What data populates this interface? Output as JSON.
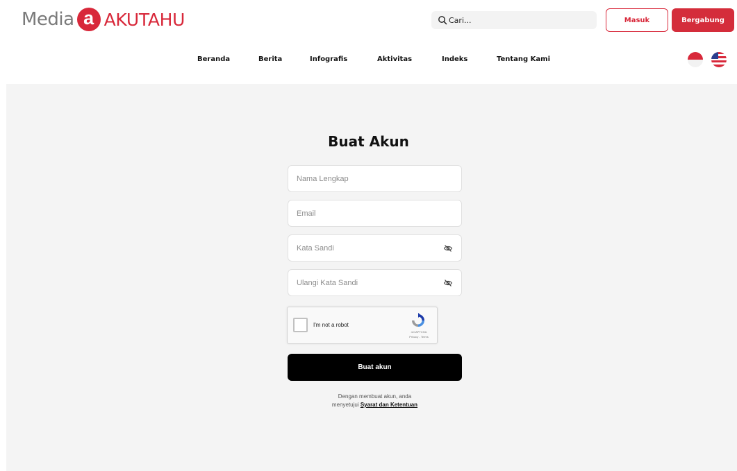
{
  "header": {
    "logo_text": "Media",
    "logo_badge": "a",
    "logo_brand": "AKUTAHU",
    "search_placeholder": "Cari...",
    "login_label": "Masuk",
    "register_label": "Bergabung"
  },
  "nav": {
    "items": [
      {
        "label": "Beranda"
      },
      {
        "label": "Berita"
      },
      {
        "label": "Infografis"
      },
      {
        "label": "Aktivitas"
      },
      {
        "label": "Indeks"
      },
      {
        "label": "Tentang Kami"
      }
    ],
    "languages": [
      "indonesia-flag-icon",
      "us-flag-icon"
    ]
  },
  "form": {
    "title": "Buat Akun",
    "full_name_placeholder": "Nama Lengkap",
    "email_placeholder": "Email",
    "password_placeholder": "Kata Sandi",
    "confirm_password_placeholder": "Ulangi Kata Sandi",
    "captcha_label": "I'm not a robot",
    "captcha_brand": "reCAPTCHA",
    "captcha_terms": "Privacy - Terms",
    "submit_label": "Buat akun",
    "terms_prefix_line1": "Dengan membuat akun, anda",
    "terms_prefix_line2": "menyetujui",
    "terms_link": "Syarat dan Ketentuan"
  },
  "colors": {
    "brand_red": "#d8283a",
    "panel_background": "#f4f4f4",
    "submit_background": "#000000"
  }
}
